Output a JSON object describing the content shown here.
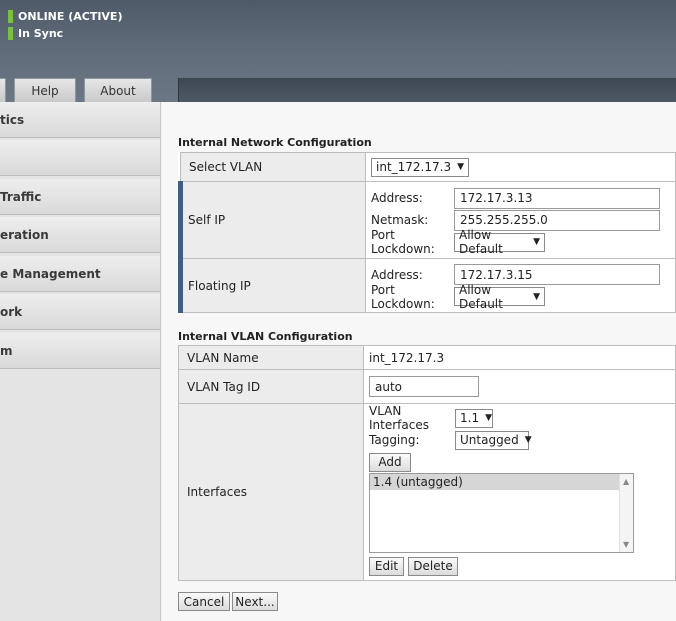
{
  "status": {
    "online": "ONLINE (ACTIVE)",
    "sync": "In Sync",
    "indicator_color": "#77c043"
  },
  "tabs": {
    "help": "Help",
    "about": "About"
  },
  "sidebar": {
    "items": [
      {
        "label": "tics"
      },
      {
        "label": ""
      },
      {
        "label": " Traffic"
      },
      {
        "label": "eration"
      },
      {
        "label": "e Management"
      },
      {
        "label": "ork"
      },
      {
        "label": "m"
      }
    ]
  },
  "internal_network": {
    "title": "Internal Network Configuration",
    "select_vlan_label": "Select VLAN",
    "select_vlan_value": "int_172.17.3",
    "self_ip": {
      "label": "Self IP",
      "address_label": "Address:",
      "address_value": "172.17.3.13",
      "netmask_label": "Netmask:",
      "netmask_value": "255.255.255.0",
      "lockdown_label": "Port Lockdown:",
      "lockdown_value": "Allow Default"
    },
    "floating_ip": {
      "label": "Floating IP",
      "address_label": "Address:",
      "address_value": "172.17.3.15",
      "lockdown_label": "Port Lockdown:",
      "lockdown_value": "Allow Default"
    }
  },
  "internal_vlan": {
    "title": "Internal VLAN Configuration",
    "name_label": "VLAN Name",
    "name_value": "int_172.17.3",
    "tag_label": "VLAN Tag ID",
    "tag_value": "auto",
    "interfaces_label": "Interfaces",
    "vlan_interfaces_label": "VLAN Interfaces",
    "vlan_interfaces_value": "1.1",
    "tagging_label": "Tagging:",
    "tagging_value": "Untagged",
    "add_label": "Add",
    "list_items": [
      "1.4 (untagged)"
    ],
    "edit_label": "Edit",
    "delete_label": "Delete"
  },
  "footer": {
    "cancel_label": "Cancel",
    "next_label": "Next..."
  }
}
